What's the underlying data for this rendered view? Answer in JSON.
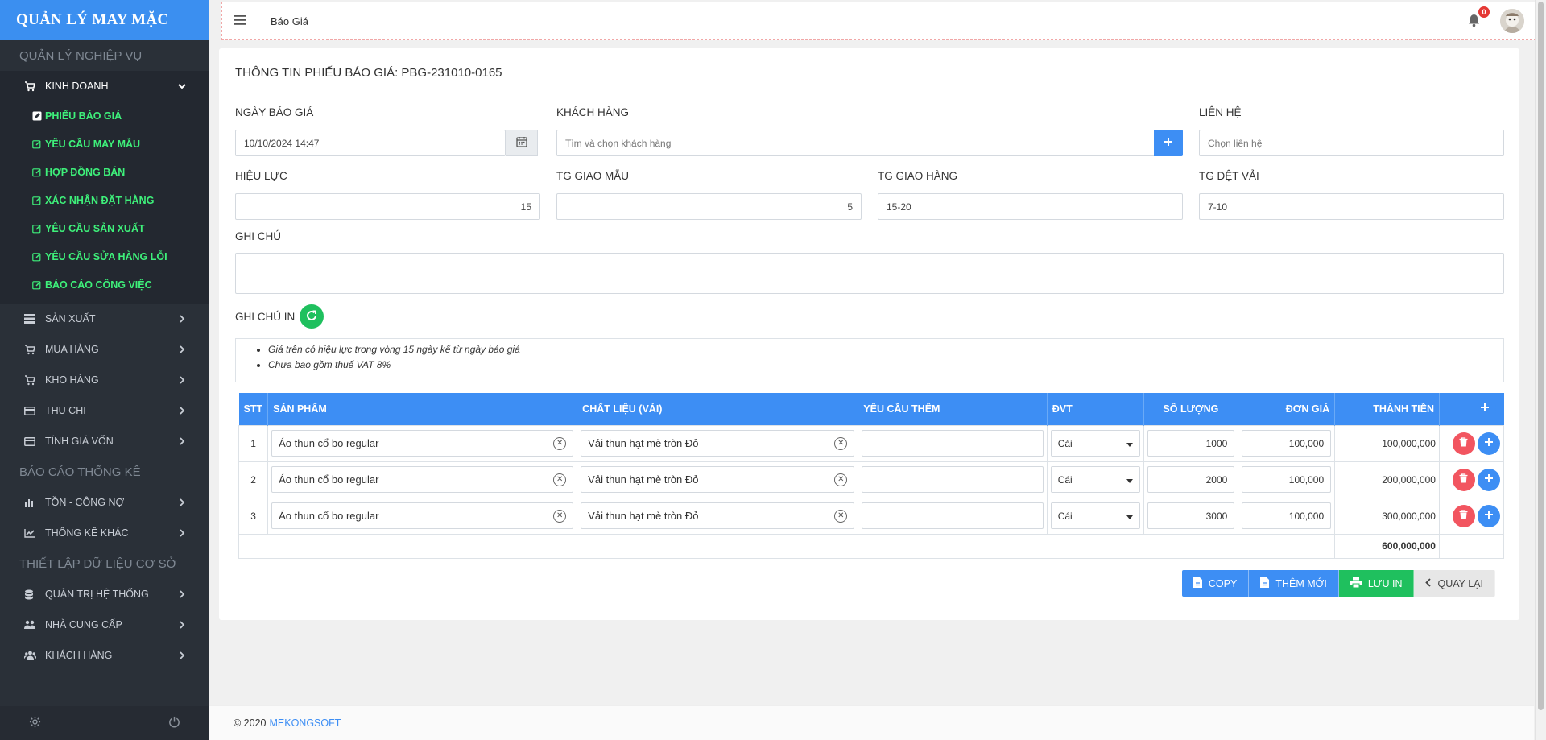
{
  "brand": "QUẢN LÝ MAY MẶC",
  "sidebar": {
    "section1": "QUẢN LÝ NGHIỆP VỤ",
    "kinhdoanh": "KINH DOANH",
    "sub": [
      "PHIẾU BÁO GIÁ",
      "YÊU CẦU MAY MẪU",
      "HỢP ĐỒNG BÁN",
      "XÁC NHẬN ĐẶT HÀNG",
      "YÊU CẦU SẢN XUẤT",
      "YÊU CẦU SỬA HÀNG LỖI",
      "BÁO CÁO CÔNG VIỆC"
    ],
    "items1": [
      "SẢN XUẤT",
      "MUA HÀNG",
      "KHO HÀNG",
      "THU CHI",
      "TÍNH GIÁ VỐN"
    ],
    "section2": "BÁO CÁO THỐNG KÊ",
    "items2": [
      "TỒN - CÔNG NỢ",
      "THỐNG KÊ KHÁC"
    ],
    "section3": "THIẾT LẬP DỮ LIỆU CƠ SỞ",
    "items3": [
      "QUẢN TRỊ HỆ THỐNG",
      "NHÀ CUNG CẤP",
      "KHÁCH HÀNG"
    ]
  },
  "topbar": {
    "breadcrumb": "Báo Giá",
    "notif_count": "0"
  },
  "form": {
    "title": "THÔNG TIN PHIẾU BÁO GIÁ: PBG-231010-0165",
    "ngay_label": "NGÀY BÁO GIÁ",
    "ngay_value": "10/10/2024 14:47",
    "khach_label": "KHÁCH HÀNG",
    "khach_ph": "Tìm và chọn khách hàng",
    "lienhe_label": "LIÊN HỆ",
    "lienhe_ph": "Chọn liên hệ",
    "hieuluc_label": "HIỆU LỰC",
    "hieuluc_value": "15",
    "tgmau_label": "TG GIAO MẪU",
    "tgmau_value": "5",
    "tggiao_label": "TG GIAO HÀNG",
    "tggiao_value": "15-20",
    "tgdet_label": "TG DỆT VẢI",
    "tgdet_value": "7-10",
    "ghichu_label": "GHI CHÚ",
    "ghichuin_label": "GHI CHÚ IN",
    "notes": [
      "Giá trên có hiệu lực trong vòng 15 ngày kể từ ngày báo giá",
      "Chưa bao gồm thuế VAT 8%"
    ]
  },
  "table": {
    "headers": [
      "STT",
      "SẢN PHẨM",
      "CHẤT LIỆU (VẢI)",
      "YÊU CẦU THÊM",
      "ĐVT",
      "SỐ LƯỢNG",
      "ĐƠN GIÁ",
      "THÀNH TIỀN"
    ],
    "rows": [
      {
        "stt": "1",
        "product": "Áo thun cổ bo regular",
        "material": "Vải thun hạt mè tròn Đỏ",
        "extra": "",
        "unit": "Cái",
        "qty": "1000",
        "price": "100,000",
        "total": "100,000,000"
      },
      {
        "stt": "2",
        "product": "Áo thun cổ bo regular",
        "material": "Vải thun hạt mè tròn Đỏ",
        "extra": "",
        "unit": "Cái",
        "qty": "2000",
        "price": "100,000",
        "total": "200,000,000"
      },
      {
        "stt": "3",
        "product": "Áo thun cổ bo regular",
        "material": "Vải thun hạt mè tròn Đỏ",
        "extra": "",
        "unit": "Cái",
        "qty": "3000",
        "price": "100,000",
        "total": "300,000,000"
      }
    ],
    "grand_total": "600,000,000"
  },
  "buttons": {
    "copy": "COPY",
    "new": "THÊM MỚI",
    "save": "LƯU IN",
    "back": "QUAY LẠI"
  },
  "footer": {
    "copyright": "© 2020",
    "company": "MEKONGSOFT"
  }
}
